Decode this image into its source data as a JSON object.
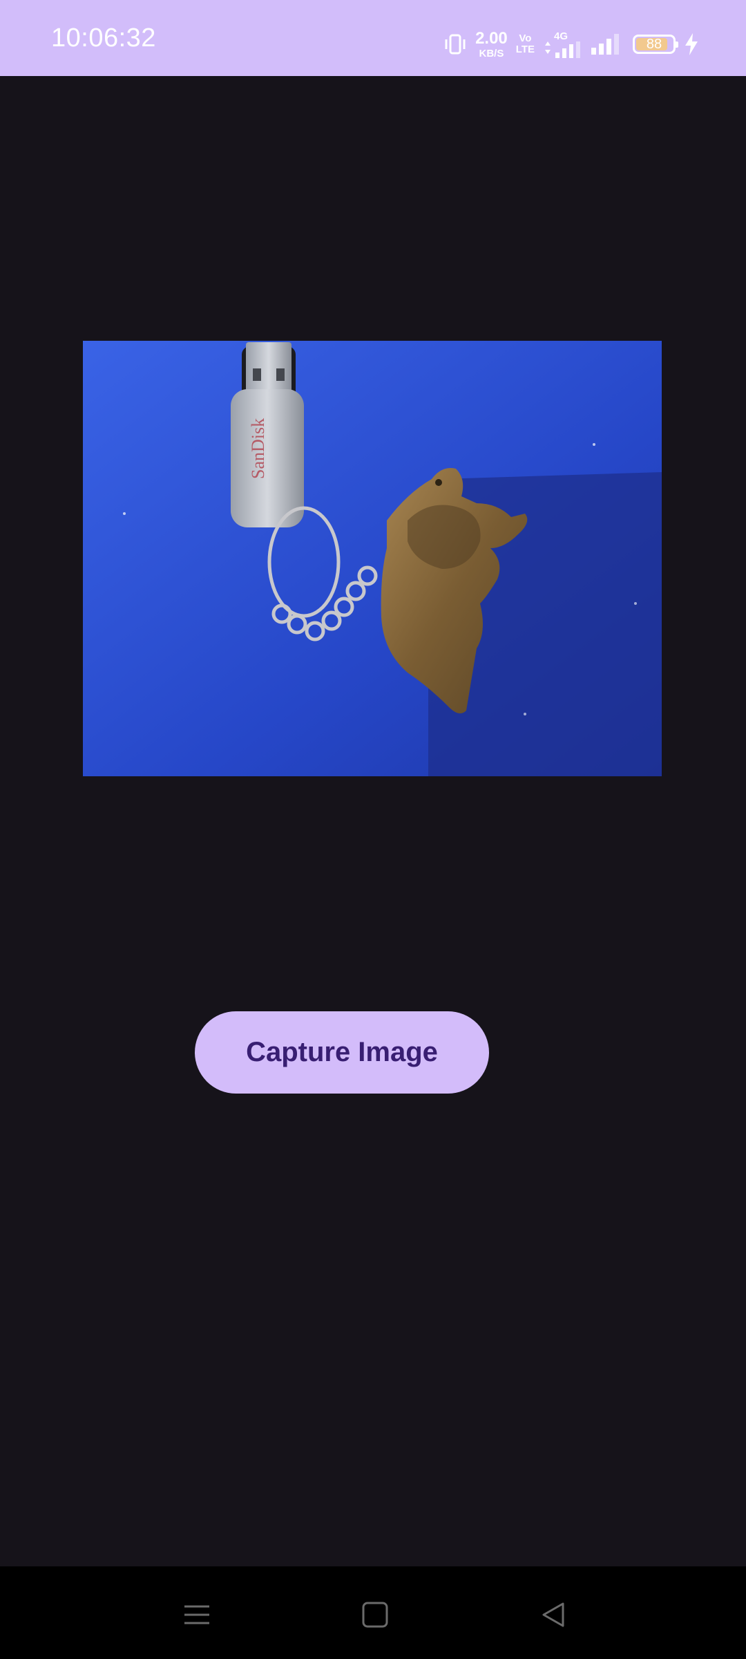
{
  "status_bar": {
    "time": "10:06:32",
    "net_speed_value": "2.00",
    "net_speed_unit": "KB/S",
    "volte_top": "Vo",
    "volte_bottom": "LTE",
    "data_type": "4G",
    "battery_level": "88",
    "battery_percent": 88,
    "charging": true,
    "icons": [
      "vibrate-icon",
      "signal-icon",
      "signal-icon",
      "battery-icon",
      "charging-bolt-icon"
    ]
  },
  "image_preview": {
    "description_visible_text": "SanDisk"
  },
  "actions": {
    "capture_label": "Capture Image"
  },
  "navigation": {
    "icons": [
      "menu-icon",
      "home-icon",
      "back-icon"
    ]
  },
  "colors": {
    "status_bar_bg": "#d2bdfa",
    "background": "#16131a",
    "button_bg": "#d3bcfa",
    "button_text": "#381e72",
    "nav_bg": "#000000"
  }
}
